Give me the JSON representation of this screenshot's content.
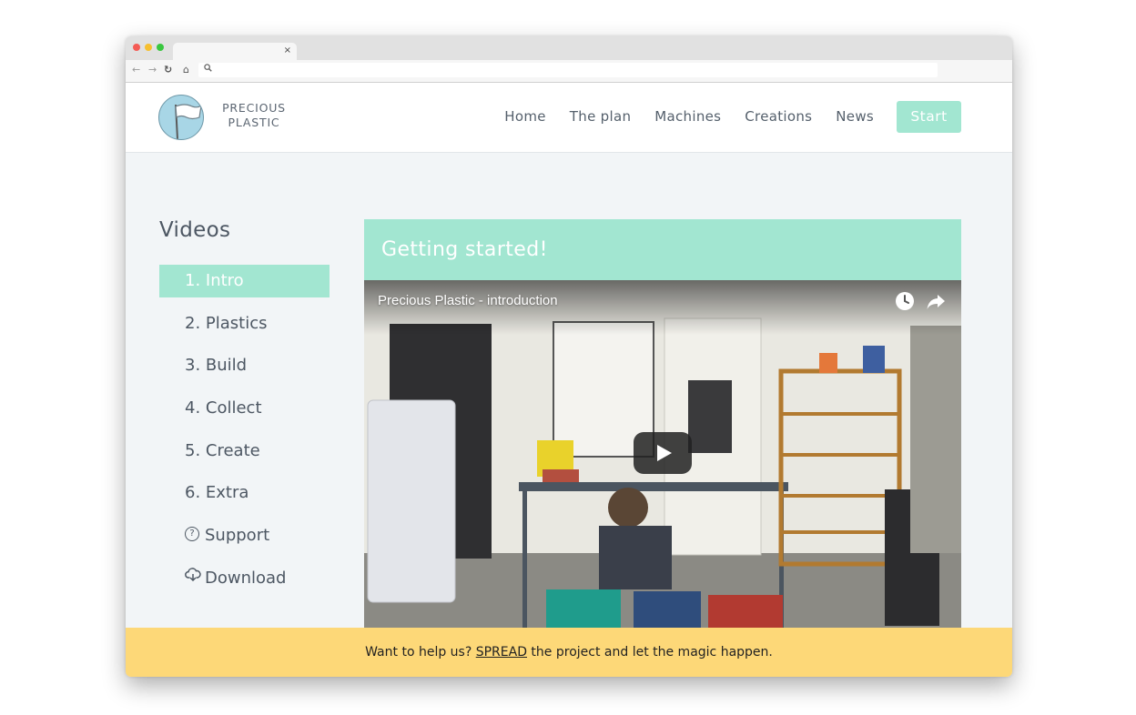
{
  "browser": {
    "tab_close": "×",
    "url": ""
  },
  "site": {
    "logo_line1": "PRECIOUS",
    "logo_line2": "PLASTIC"
  },
  "nav": {
    "items": [
      "Home",
      "The plan",
      "Machines",
      "Creations",
      "News"
    ],
    "start_label": "Start"
  },
  "sidebar": {
    "title": "Videos",
    "items": [
      "1. Intro",
      "2. Plastics",
      "3. Build",
      "4. Collect",
      "5. Create",
      "6. Extra",
      "Support",
      "Download"
    ],
    "active_index": 0
  },
  "content": {
    "heading": "Getting started!",
    "video_title": "Precious Plastic - introduction"
  },
  "footer": {
    "pre": "Want to help us? ",
    "link": "SPREAD",
    "post": " the project and let the magic happen."
  },
  "colors": {
    "accent_mint": "#a2e6d1",
    "footer_yellow": "#fdd878",
    "logo_blue": "#a8d6e6"
  },
  "icons": [
    "back-arrow-icon",
    "forward-arrow-icon",
    "reload-icon",
    "home-icon",
    "search-icon",
    "help-circle-icon",
    "cloud-download-icon",
    "clock-icon",
    "share-icon",
    "play-icon"
  ]
}
